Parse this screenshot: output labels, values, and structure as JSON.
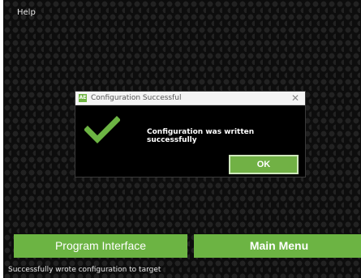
{
  "menu": {
    "help_label": "Help"
  },
  "dialog": {
    "title": "Configuration Successful",
    "app_icon_text": "AE",
    "close_glyph": "✕",
    "message": "Configuration was written successfully",
    "ok_label": "OK",
    "icon": "checkmark-icon"
  },
  "buttons": {
    "program_interface": "Program Interface",
    "main_menu": "Main Menu"
  },
  "status": {
    "text": "Successfully wrote configuration to target"
  },
  "colors": {
    "accent_green": "#6cb443",
    "background": "#0d0d0d"
  }
}
